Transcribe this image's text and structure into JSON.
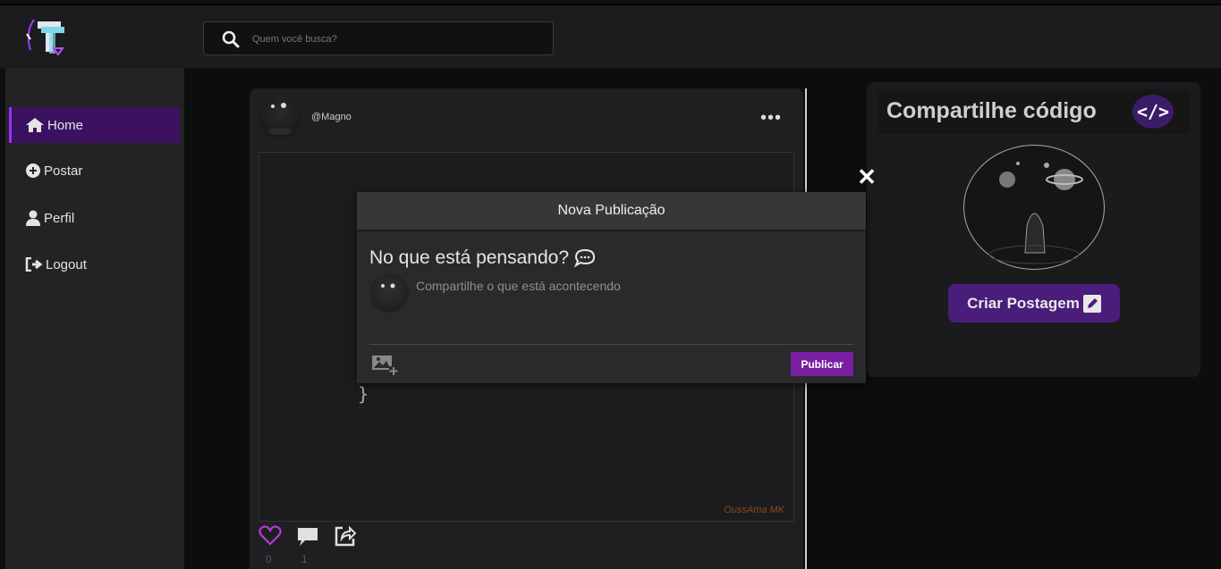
{
  "search": {
    "placeholder": "Quem você busca?",
    "icon": "search-icon"
  },
  "sidebar": {
    "items": [
      {
        "label": "Home",
        "icon": "home-icon",
        "active": true
      },
      {
        "label": "Postar",
        "icon": "plus-circle-icon"
      },
      {
        "label": "Perfil",
        "icon": "user-icon"
      },
      {
        "label": "Logout",
        "icon": "logout-icon"
      }
    ]
  },
  "post": {
    "username": "@Magno",
    "menu": "•••",
    "code_brace": "}",
    "signature": "OussAma MK",
    "likes": "0",
    "comments": "1"
  },
  "modal": {
    "title": "Nova Publicação",
    "question": "No que está pensando?",
    "placeholder": "Compartilhe o que está acontecendo",
    "publish_label": "Publicar",
    "close": "✕"
  },
  "right_panel": {
    "title": "Compartilhe código",
    "code_icon": "</>",
    "button_label": "Criar Postagem"
  },
  "colors": {
    "accent": "#7a1fa2",
    "active_nav": "#3c1260",
    "like": "#b23bd6"
  }
}
